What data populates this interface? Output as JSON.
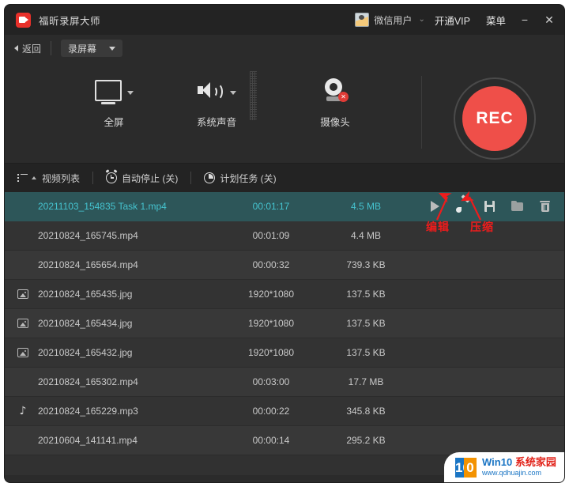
{
  "titlebar": {
    "app_title": "福昕录屏大师",
    "logo_icon": "video-play-logo-icon",
    "avatar_icon": "user-avatar-icon",
    "user_name": "微信用户",
    "chevron": "⌄",
    "vip_label": "开通VIP",
    "menu_label": "菜单",
    "minimize_label": "−",
    "close_label": "✕"
  },
  "subbar": {
    "back_label": "返回",
    "mode_label": "录屏幕"
  },
  "capture": {
    "options": [
      {
        "label": "全屏",
        "icon": "monitor-icon",
        "has_caret": true
      },
      {
        "label": "系统声音",
        "icon": "speaker-icon",
        "has_caret": true
      },
      {
        "label": "摄像头",
        "icon": "webcam-disabled-icon",
        "has_caret": false,
        "badge": "✕"
      }
    ],
    "rec_label": "REC",
    "rec_color": "#ef4f49"
  },
  "list_toolbar": {
    "video_list_label": "视频列表",
    "auto_stop_label": "自动停止 (关)",
    "scheduled_task_label": "计划任务 (关)"
  },
  "file_list": {
    "rows": [
      {
        "name": "20211103_154835 Task 1.mp4",
        "duration": "00:01:17",
        "size": "4.5 MB",
        "icon": "",
        "selected": true
      },
      {
        "name": "20210824_165745.mp4",
        "duration": "00:01:09",
        "size": "4.4 MB",
        "icon": "",
        "selected": false
      },
      {
        "name": "20210824_165654.mp4",
        "duration": "00:00:32",
        "size": "739.3 KB",
        "icon": "",
        "selected": false
      },
      {
        "name": "20210824_165435.jpg",
        "duration": "1920*1080",
        "size": "137.5 KB",
        "icon": "image-icon",
        "selected": false
      },
      {
        "name": "20210824_165434.jpg",
        "duration": "1920*1080",
        "size": "137.5 KB",
        "icon": "image-icon",
        "selected": false
      },
      {
        "name": "20210824_165432.jpg",
        "duration": "1920*1080",
        "size": "137.5 KB",
        "icon": "image-icon",
        "selected": false
      },
      {
        "name": "20210824_165302.mp4",
        "duration": "00:03:00",
        "size": "17.7 MB",
        "icon": "",
        "selected": false
      },
      {
        "name": "20210824_165229.mp3",
        "duration": "00:00:22",
        "size": "345.8 KB",
        "icon": "music-note-icon",
        "selected": false
      },
      {
        "name": "20210604_141141.mp4",
        "duration": "00:00:14",
        "size": "295.2 KB",
        "icon": "",
        "selected": false
      }
    ],
    "row_actions": [
      "play-icon",
      "edit-brush-icon",
      "compress-icon",
      "open-folder-icon",
      "delete-icon"
    ],
    "selected_row_bg": "#2d5659",
    "selected_row_fg": "#45c3cf"
  },
  "annotations": {
    "color": "#ee1c1c",
    "items": [
      {
        "label": "编辑",
        "target": "edit-brush-icon"
      },
      {
        "label": "压缩",
        "target": "compress-icon"
      }
    ]
  },
  "watermark": {
    "logo_one": "10",
    "logo_zero": "0",
    "brand_win": "Win",
    "brand_ten": "10",
    "brand_cn": "系统家园",
    "site": "www.qdhuajin.com"
  }
}
